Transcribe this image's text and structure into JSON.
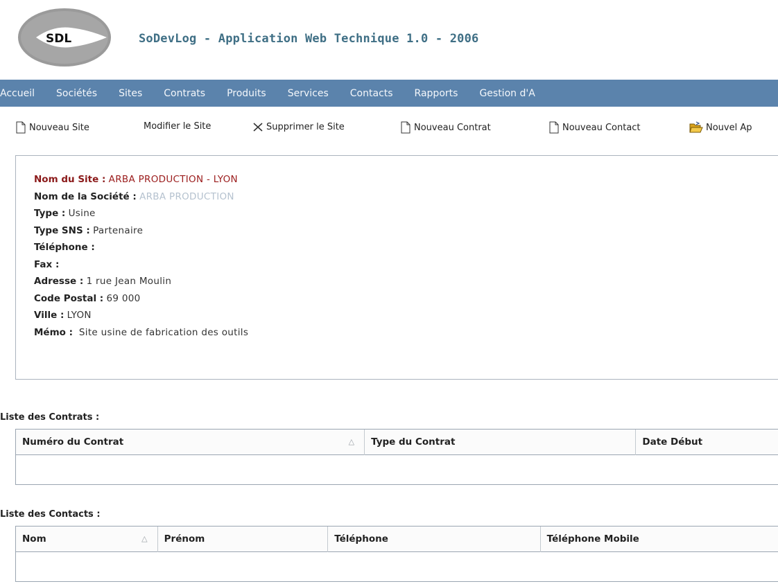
{
  "header": {
    "logo_text": "SDL",
    "title": "SoDevLog - Application Web Technique 1.0 - 2006"
  },
  "nav": {
    "items": [
      "Accueil",
      "Sociétés",
      "Sites",
      "Contrats",
      "Produits",
      "Services",
      "Contacts",
      "Rapports",
      "Gestion d'A"
    ]
  },
  "toolbar": {
    "new_site": "Nouveau Site",
    "edit_site": "Modifier le Site",
    "delete_site": "Supprimer le Site",
    "new_contract": "Nouveau Contrat",
    "new_contact": "Nouveau Contact",
    "new_ap": "Nouvel Ap"
  },
  "site": {
    "name_label": "Nom du Site :",
    "name_value": "ARBA PRODUCTION - LYON",
    "company_label": "Nom de la Société :",
    "company_value": "ARBA PRODUCTION",
    "type_label": "Type :",
    "type_value": "Usine",
    "sns_label": "Type SNS :",
    "sns_value": "Partenaire",
    "phone_label": "Téléphone :",
    "phone_value": "",
    "fax_label": "Fax :",
    "fax_value": "",
    "address_label": "Adresse :",
    "address_value": "1 rue Jean Moulin",
    "postal_label": "Code Postal :",
    "postal_value": "69 000",
    "city_label": "Ville :",
    "city_value": "LYON",
    "memo_label": "Mémo :",
    "memo_value": " Site usine de fabrication des outils"
  },
  "contracts": {
    "title": "Liste des Contrats :",
    "columns": [
      "Numéro du Contrat",
      "Type du Contrat",
      "Date Début"
    ],
    "sort_glyph": "△"
  },
  "contacts": {
    "title": "Liste des Contacts :",
    "columns": [
      "Nom",
      "Prénom",
      "Téléphone",
      "Téléphone Mobile"
    ],
    "sort_glyph": "△"
  },
  "colors": {
    "navbar": "#5b83ac",
    "title": "#3f6f85",
    "site_name": "#9b1c1c",
    "company_link": "#b5c2cf"
  },
  "icons": [
    "logo-icon",
    "new-doc-icon",
    "delete-x-icon",
    "open-folder-icon",
    "sort-asc-icon"
  ]
}
